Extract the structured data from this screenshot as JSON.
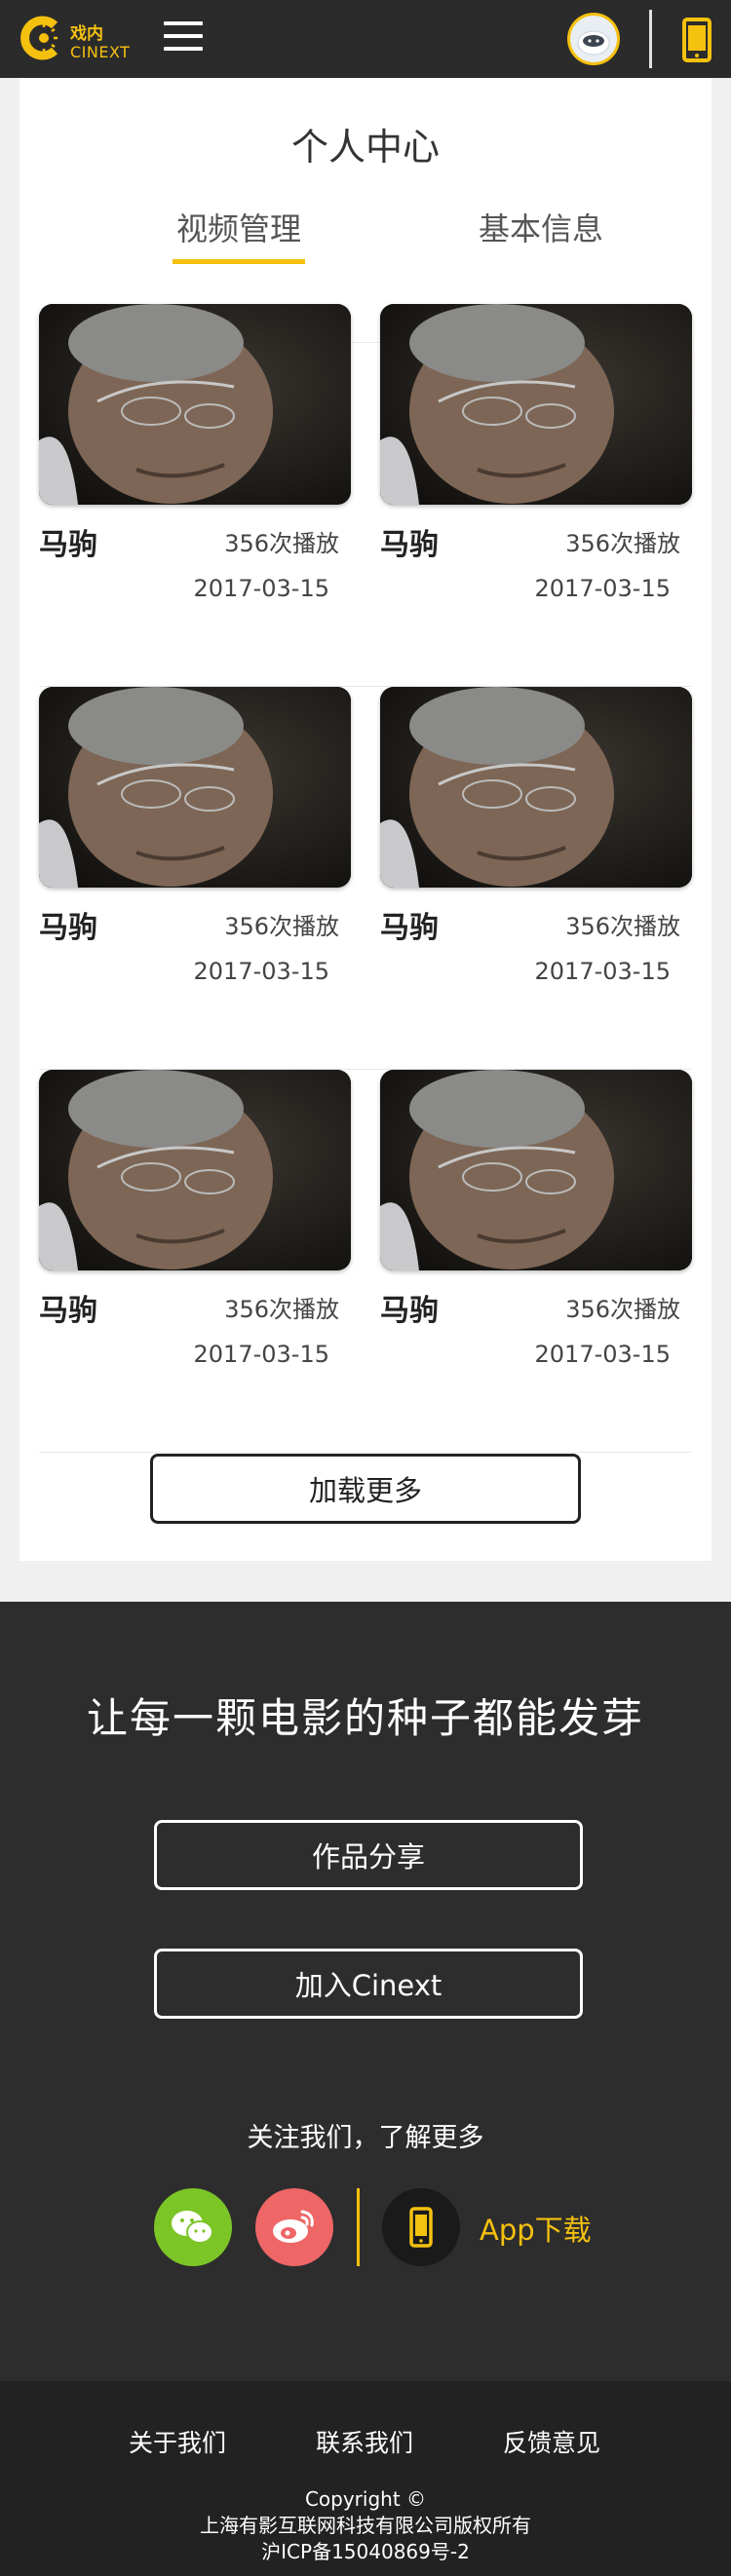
{
  "header": {
    "logo_cn": "戏内",
    "logo_en": "CINEXT",
    "brand_color": "#f5c10f"
  },
  "main": {
    "title": "个人中心",
    "tabs": [
      {
        "label": "视频管理",
        "active": true
      },
      {
        "label": "基本信息",
        "active": false
      }
    ],
    "videos": [
      {
        "title": "马驹",
        "plays": "356次播放",
        "date": "2017-03-15"
      },
      {
        "title": "马驹",
        "plays": "356次播放",
        "date": "2017-03-15"
      },
      {
        "title": "马驹",
        "plays": "356次播放",
        "date": "2017-03-15"
      },
      {
        "title": "马驹",
        "plays": "356次播放",
        "date": "2017-03-15"
      },
      {
        "title": "马驹",
        "plays": "356次播放",
        "date": "2017-03-15"
      },
      {
        "title": "马驹",
        "plays": "356次播放",
        "date": "2017-03-15"
      }
    ],
    "load_more": "加载更多"
  },
  "footer": {
    "slogan": "让每一颗电影的种子都能发芽",
    "share_button": "作品分享",
    "join_button": "加入Cinext",
    "follow_text": "关注我们，了解更多",
    "app_download": "App下载",
    "links": [
      "关于我们",
      "联系我们",
      "反馈意见"
    ],
    "copyright": "Copyright ©",
    "company": "上海有影互联网科技有限公司版权所有",
    "icp": "沪ICP备15040869号-2"
  }
}
